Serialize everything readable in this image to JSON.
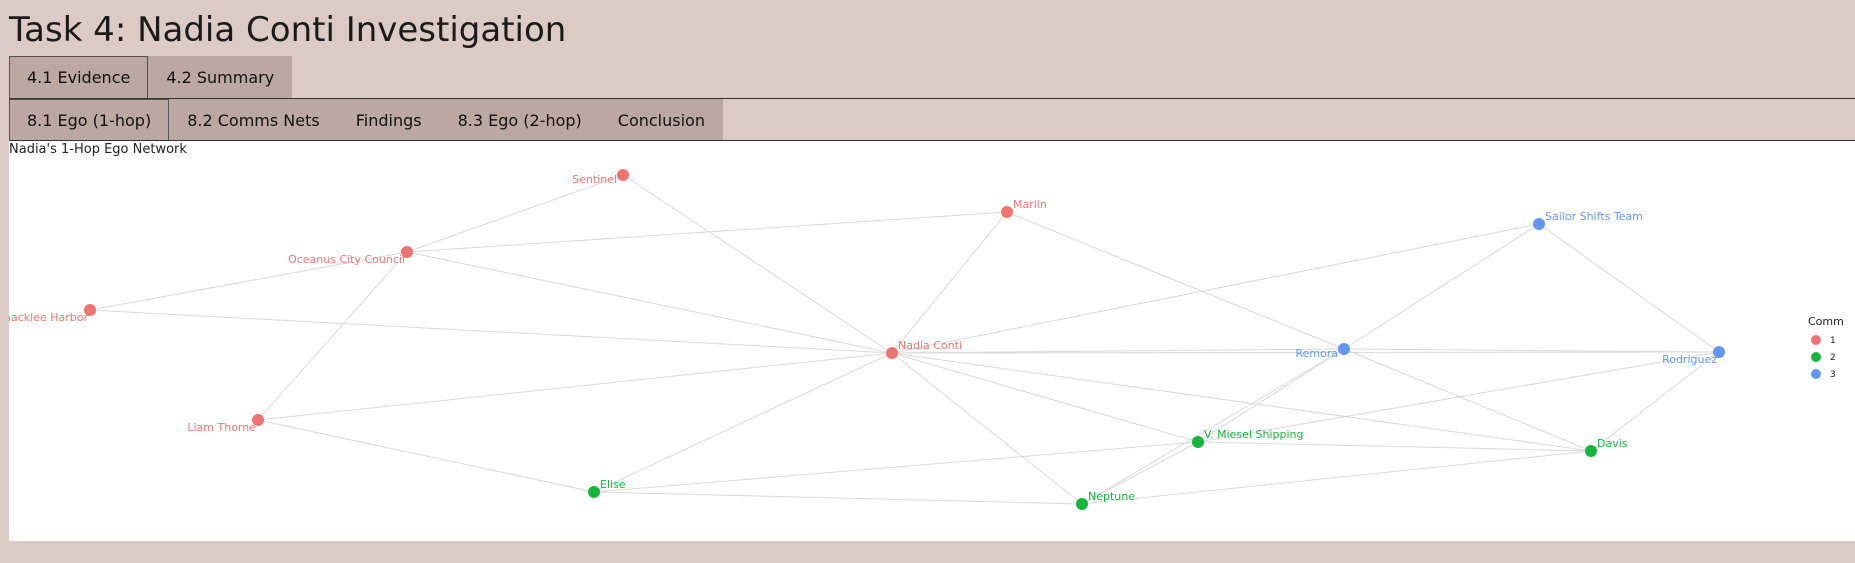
{
  "page_title": "Task 4: Nadia Conti Investigation",
  "main_tabs": [
    {
      "label": "4.1 Evidence",
      "active": true
    },
    {
      "label": "4.2 Summary",
      "active": false
    }
  ],
  "sub_tabs": [
    {
      "label": "8.1 Ego (1-hop)",
      "active": true
    },
    {
      "label": "8.2 Comms Nets",
      "active": false
    },
    {
      "label": "Findings",
      "active": false
    },
    {
      "label": "8.3 Ego (2-hop)",
      "active": false
    },
    {
      "label": "Conclusion",
      "active": false
    }
  ],
  "plot_title": "Nadia's 1-Hop Ego Network",
  "colors": {
    "community_1": "#ef7471",
    "community_2": "#17b53d",
    "community_3": "#6397ef",
    "edge": "#d9d9d9"
  },
  "legend": {
    "title": "Comm",
    "entries": [
      "1",
      "2",
      "3"
    ]
  },
  "network": {
    "nodes": [
      {
        "id": "Nadia Conti",
        "community": 1
      },
      {
        "id": "Sentinel",
        "community": 1
      },
      {
        "id": "Marlin",
        "community": 1
      },
      {
        "id": "Oceanus City Council",
        "community": 1
      },
      {
        "id": "Haacklee Harbor",
        "community": 1
      },
      {
        "id": "Liam Thorne",
        "community": 1
      },
      {
        "id": "Sailor Shifts Team",
        "community": 3
      },
      {
        "id": "Remora",
        "community": 3
      },
      {
        "id": "Rodriguez",
        "community": 3
      },
      {
        "id": "V. Miesel Shipping",
        "community": 2
      },
      {
        "id": "Davis",
        "community": 2
      },
      {
        "id": "Elise",
        "community": 2
      },
      {
        "id": "Neptune",
        "community": 2
      }
    ],
    "edges": [
      [
        "Nadia Conti",
        "Sentinel"
      ],
      [
        "Nadia Conti",
        "Marlin"
      ],
      [
        "Nadia Conti",
        "Oceanus City Council"
      ],
      [
        "Nadia Conti",
        "Haacklee Harbor"
      ],
      [
        "Nadia Conti",
        "Liam Thorne"
      ],
      [
        "Nadia Conti",
        "Remora"
      ],
      [
        "Nadia Conti",
        "Rodriguez"
      ],
      [
        "Nadia Conti",
        "Sailor Shifts Team"
      ],
      [
        "Nadia Conti",
        "V. Miesel Shipping"
      ],
      [
        "Nadia Conti",
        "Davis"
      ],
      [
        "Nadia Conti",
        "Elise"
      ],
      [
        "Nadia Conti",
        "Neptune"
      ],
      [
        "Sentinel",
        "Oceanus City Council"
      ],
      [
        "Marlin",
        "Oceanus City Council"
      ],
      [
        "Marlin",
        "Remora"
      ],
      [
        "Oceanus City Council",
        "Haacklee Harbor"
      ],
      [
        "Oceanus City Council",
        "Liam Thorne"
      ],
      [
        "Liam Thorne",
        "Elise"
      ],
      [
        "Sailor Shifts Team",
        "Remora"
      ],
      [
        "Sailor Shifts Team",
        "Rodriguez"
      ],
      [
        "Remora",
        "Rodriguez"
      ],
      [
        "Remora",
        "Davis"
      ],
      [
        "Remora",
        "V. Miesel Shipping"
      ],
      [
        "Remora",
        "Neptune"
      ],
      [
        "Rodriguez",
        "V. Miesel Shipping"
      ],
      [
        "Rodriguez",
        "Davis"
      ],
      [
        "V. Miesel Shipping",
        "Davis"
      ],
      [
        "V. Miesel Shipping",
        "Elise"
      ],
      [
        "V. Miesel Shipping",
        "Neptune"
      ],
      [
        "Elise",
        "Neptune"
      ],
      [
        "Davis",
        "Neptune"
      ]
    ]
  }
}
